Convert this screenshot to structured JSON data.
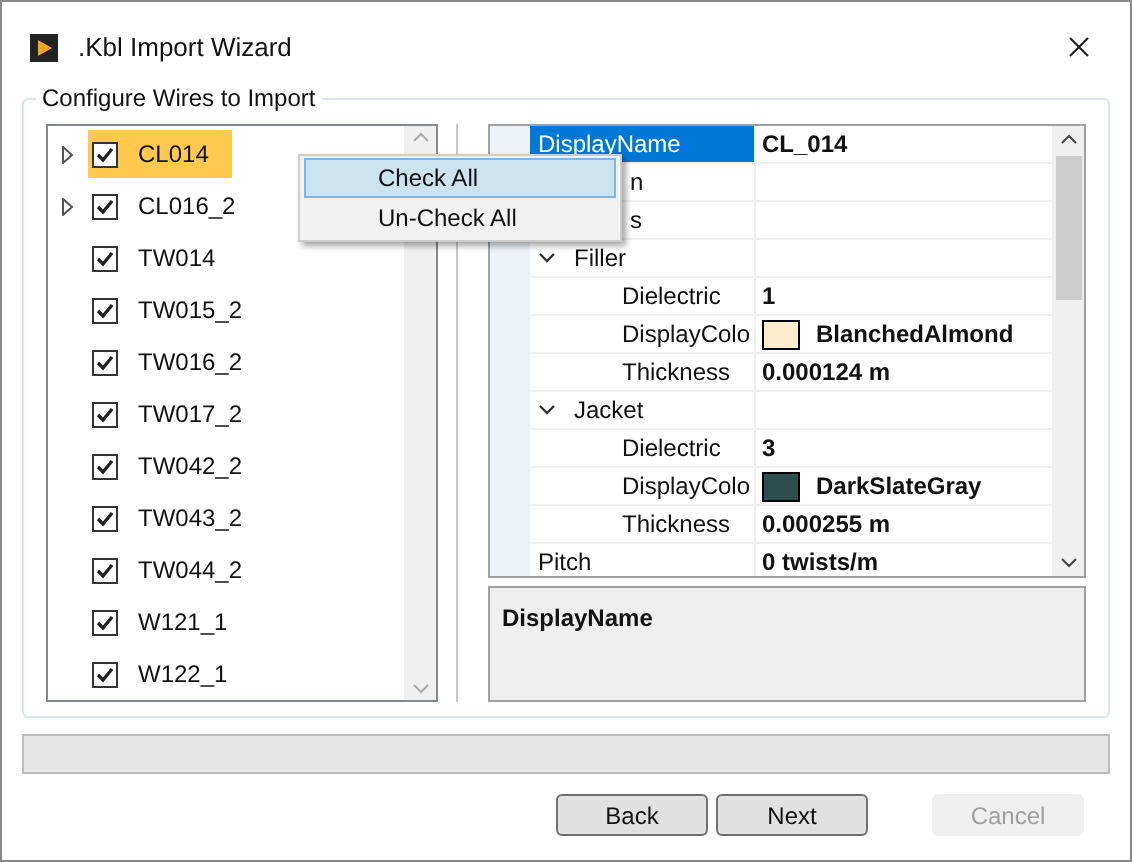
{
  "window": {
    "title": ".Kbl Import Wizard"
  },
  "group_title": "Configure Wires to Import",
  "wires": [
    {
      "label": "CL014",
      "kind": "group",
      "expanded": false,
      "checked": true,
      "selected": true
    },
    {
      "label": "CL016_2",
      "kind": "group",
      "expanded": false,
      "checked": true,
      "selected": false
    },
    {
      "label": "TW014",
      "kind": "wire",
      "checked": true,
      "selected": false
    },
    {
      "label": "TW015_2",
      "kind": "wire",
      "checked": true,
      "selected": false
    },
    {
      "label": "TW016_2",
      "kind": "wire",
      "checked": true,
      "selected": false
    },
    {
      "label": "TW017_2",
      "kind": "wire",
      "checked": true,
      "selected": false
    },
    {
      "label": "TW042_2",
      "kind": "wire",
      "checked": true,
      "selected": false
    },
    {
      "label": "TW043_2",
      "kind": "wire",
      "checked": true,
      "selected": false
    },
    {
      "label": "TW044_2",
      "kind": "wire",
      "checked": true,
      "selected": false
    },
    {
      "label": "W121_1",
      "kind": "wire",
      "checked": true,
      "selected": false
    },
    {
      "label": "W122_1",
      "kind": "wire",
      "checked": true,
      "selected": false
    }
  ],
  "context_menu": [
    {
      "label": "Check All",
      "selected": true
    },
    {
      "label": "Un-Check All",
      "selected": false
    }
  ],
  "properties": [
    {
      "kind": "property",
      "name": "DisplayName",
      "value": "CL_014",
      "selected": true
    },
    {
      "kind": "covered",
      "name": "n",
      "selected": false
    },
    {
      "kind": "covered",
      "name": "s",
      "selected": false
    },
    {
      "kind": "category",
      "name": "Filler",
      "expanded": true,
      "selected": false,
      "children": [
        {
          "kind": "property",
          "name": "Dielectric",
          "value": "1",
          "selected": false
        },
        {
          "kind": "color",
          "name": "DisplayColo",
          "value": "BlanchedAlmond",
          "color": "#ffebcd",
          "selected": false
        },
        {
          "kind": "property",
          "name": "Thickness",
          "value": "0.000124 m",
          "selected": false
        }
      ]
    },
    {
      "kind": "category",
      "name": "Jacket",
      "expanded": true,
      "selected": false,
      "children": [
        {
          "kind": "property",
          "name": "Dielectric",
          "value": "3",
          "selected": false
        },
        {
          "kind": "color",
          "name": "DisplayColo",
          "value": "DarkSlateGray",
          "color": "#2f4f4f",
          "selected": false
        },
        {
          "kind": "property",
          "name": "Thickness",
          "value": "0.000255 m",
          "selected": false
        }
      ]
    },
    {
      "kind": "property",
      "name": "Pitch",
      "value": "0 twists/m",
      "selected": false
    }
  ],
  "description": {
    "title": "DisplayName"
  },
  "progress": {
    "level": 0
  },
  "buttons": [
    {
      "label": "Back",
      "disabled": false
    },
    {
      "label": "Next",
      "disabled": false
    },
    {
      "label": "Cancel",
      "disabled": true
    }
  ]
}
